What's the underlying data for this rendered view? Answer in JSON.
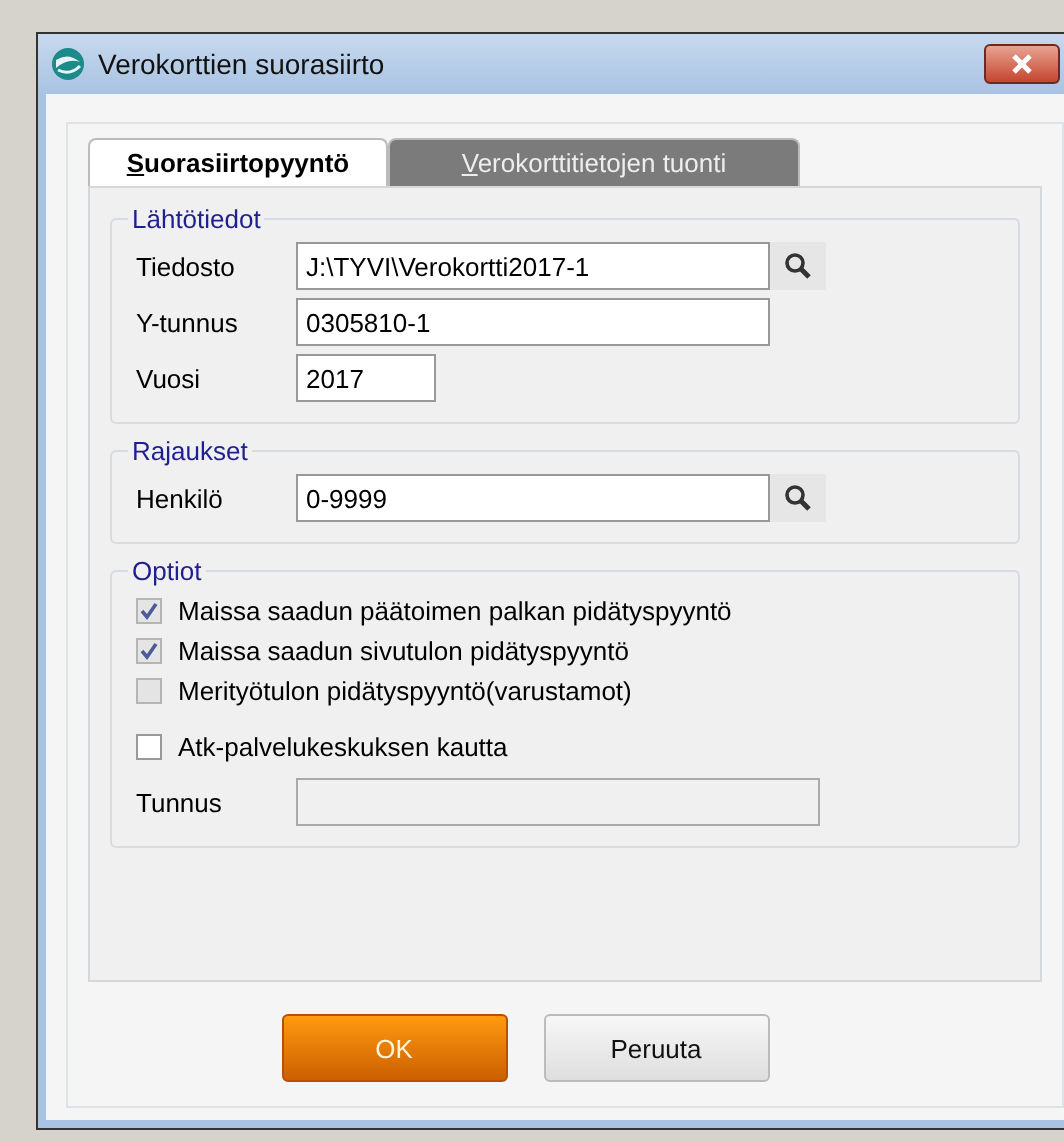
{
  "window": {
    "title": "Verokorttien suorasiirto"
  },
  "tabs": [
    {
      "label": "Suorasiirtopyyntö",
      "selected": true
    },
    {
      "label": "Verokorttitietojen tuonti",
      "selected": false
    }
  ],
  "groups": [
    {
      "title": "Lähtötiedot",
      "fields": [
        {
          "label": "Tiedosto",
          "value": "J:\\TYVI\\Verokortti2017-1",
          "lookup": true
        },
        {
          "label": "Y-tunnus",
          "value": "0305810-1",
          "lookup": false
        },
        {
          "label": "Vuosi",
          "value": "2017",
          "lookup": false
        }
      ]
    },
    {
      "title": "Rajaukset",
      "fields": [
        {
          "label": "Henkilö",
          "value": "0-9999",
          "lookup": true
        }
      ]
    },
    {
      "title": "Optiot",
      "options": [
        {
          "label": "Maissa saadun päätoimen palkan pidätyspyyntö",
          "checked": true,
          "disabled": true
        },
        {
          "label": "Maissa saadun sivutulon pidätyspyyntö",
          "checked": true,
          "disabled": true
        },
        {
          "label": "Merityötulon pidätyspyyntö(varustamot)",
          "checked": false,
          "disabled": true
        },
        {
          "label": "Atk-palvelukeskuksen kautta",
          "checked": false,
          "disabled": false
        }
      ],
      "fields": [
        {
          "label": "Tunnus",
          "lookup": false,
          "disabled": true
        }
      ]
    }
  ],
  "buttons": [
    {
      "label": "OK",
      "kind": "primary"
    },
    {
      "label": "Peruuta",
      "kind": "secondary"
    }
  ]
}
